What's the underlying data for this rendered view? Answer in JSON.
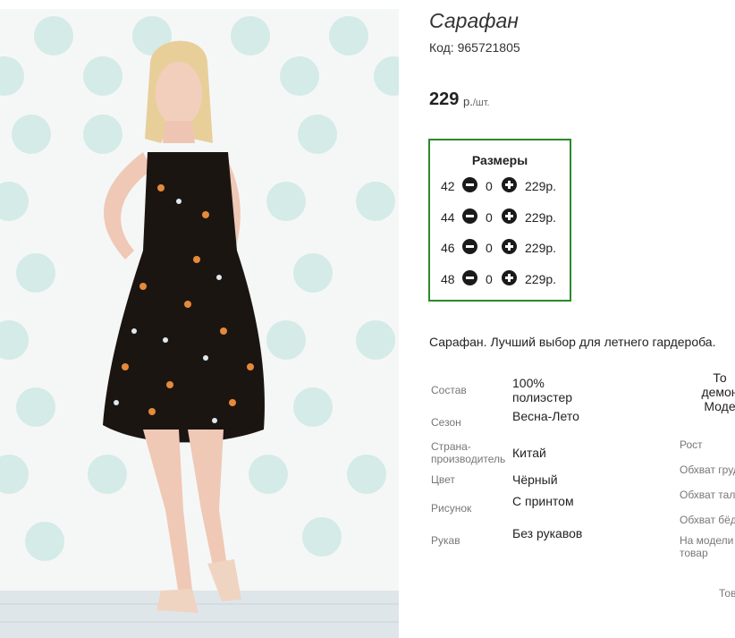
{
  "product": {
    "title": "Сарафан",
    "code": "Код: 965721805",
    "price": "229",
    "currency": "р.",
    "per_unit": "/шт.",
    "description": "Сарафан. Лучший выбор для летнего гардероба."
  },
  "sizes": {
    "title": "Размеры",
    "rows": [
      {
        "size": "42",
        "qty": "0",
        "price": "229р."
      },
      {
        "size": "44",
        "qty": "0",
        "price": "229р."
      },
      {
        "size": "46",
        "qty": "0",
        "price": "229р."
      },
      {
        "size": "48",
        "qty": "0",
        "price": "229р."
      }
    ]
  },
  "attributes": [
    {
      "label": "Состав",
      "value": "100% полиэстер"
    },
    {
      "label": "Сезон",
      "value": "Весна-Лето"
    },
    {
      "label": "Страна-производитель",
      "label_line1": "Страна-",
      "label_line2": "производитель",
      "value": "Китай"
    },
    {
      "label": "Цвет",
      "value": "Чёрный"
    },
    {
      "label": "Рисунок",
      "value": "С принтом"
    },
    {
      "label": "Рукав",
      "value": "Без рукавов"
    }
  ],
  "model_info": {
    "heading_line1": "То",
    "heading_line2": "демон",
    "heading_line3": "Моде",
    "labels": [
      "Рост",
      "Обхват груд",
      "Обхват тал",
      "Обхват бёд"
    ],
    "on_model_line1": "На модели",
    "on_model_line2": "товар",
    "footer": "Тов"
  },
  "icons": {
    "minus": "minus-circle-icon",
    "plus": "plus-circle-icon"
  },
  "colors": {
    "sizes_border": "#2b8a2b",
    "add_button": "#b5e61d",
    "dot_pattern": "#cfe7e3"
  }
}
